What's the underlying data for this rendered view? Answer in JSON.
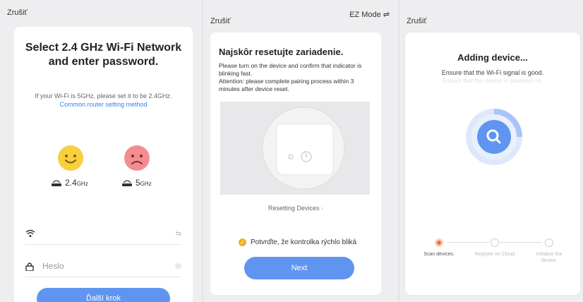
{
  "colors": {
    "accent": "#5f95f0",
    "link": "#3c7cf0",
    "scan_active": "#f26a3a",
    "check": "#f0b022"
  },
  "panel1": {
    "cancel": "Zrušiť",
    "title": "Select 2.4 GHz Wi-Fi Network and enter password.",
    "subtitle": "If your Wi-Fi is 5GHz, please set it to be 2.4GHz.",
    "link": "Common router setting method",
    "band_24": "2.4",
    "band_5": "5",
    "unit": "GHz",
    "wifi_icon": "wifi-icon",
    "switch_icon": "switch-icon",
    "password_placeholder": "Heslo",
    "lock_icon": "lock-icon",
    "eye_icon": "eye-icon",
    "next_button": "Ďalší krok"
  },
  "panel2": {
    "cancel": "Zrušiť",
    "mode": "EZ Mode",
    "title": "Najskôr resetujte zariadenie.",
    "body1": "Please turn on the device and confirm that indicator is blinking fast.",
    "body2": "Attention: please complete pairing process within 3 minutes after device reset.",
    "resetting": "Resetting Devices",
    "confirm": "Potvrďte, že kontrolka rýchlo bliká",
    "next_button": "Next"
  },
  "panel3": {
    "cancel": "Zrušiť",
    "title": "Adding device...",
    "subtitle": "Ensure that the Wi-Fi signal is good.",
    "subtitle2": "Ensure that the device is powered on.",
    "steps": [
      {
        "label": "Scan devices."
      },
      {
        "label": "Register on Cloud"
      },
      {
        "label": "Initialize the device."
      }
    ]
  }
}
